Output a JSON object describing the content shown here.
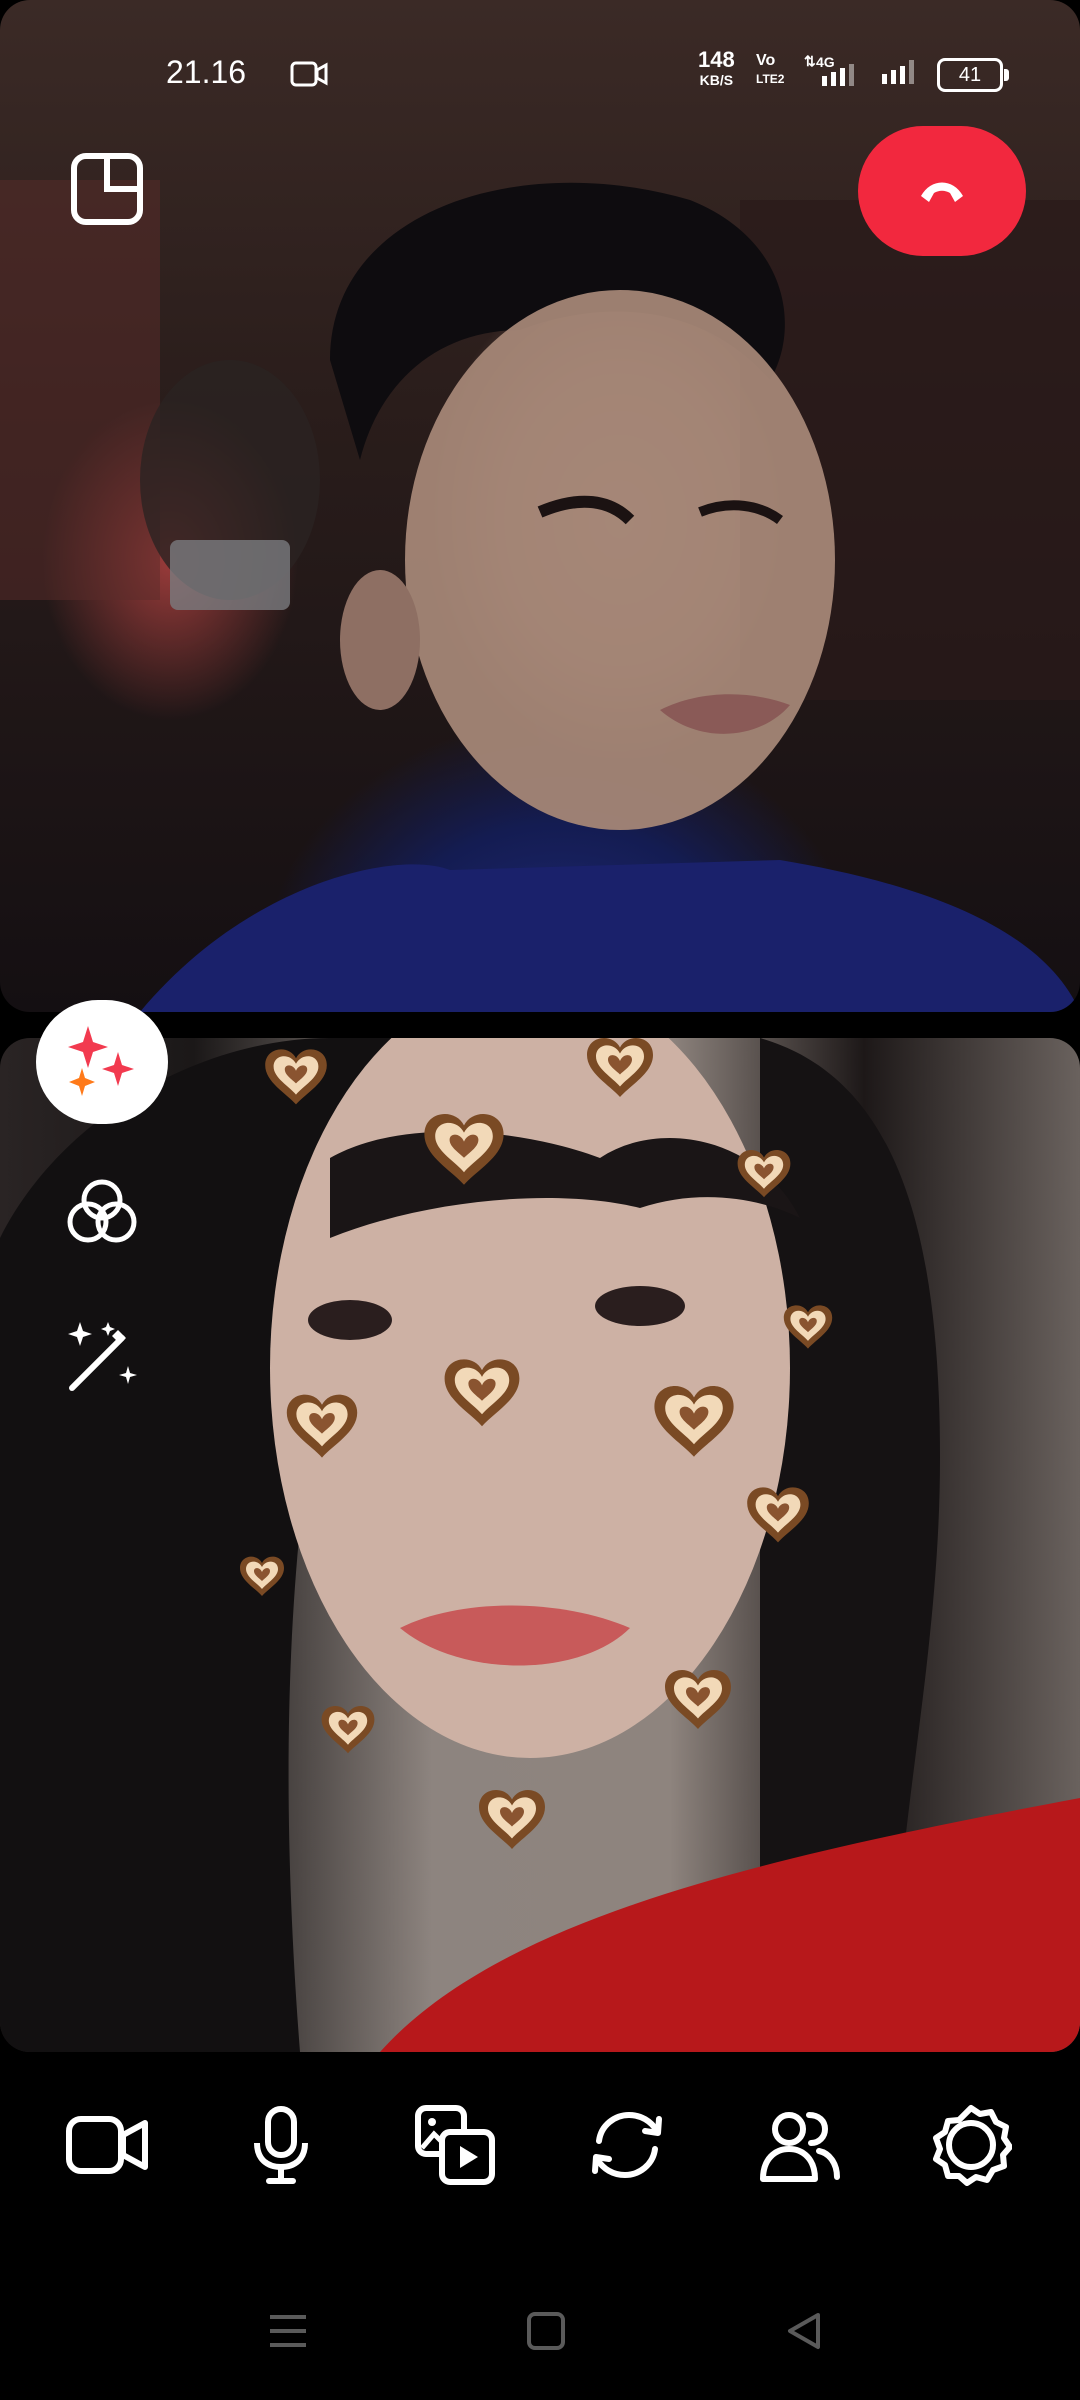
{
  "status_bar": {
    "time": "21.16",
    "net_speed_value": "148",
    "net_speed_unit": "KB/S",
    "volte_top": "Vo",
    "volte_bottom": "LTE2",
    "network_type": "4G",
    "battery_level": "41"
  },
  "icons": {
    "status_camera": "video-camera-icon",
    "layout": "layout-toggle-icon",
    "end_call": "hang-up-phone-icon",
    "effects": "sparkles-icon",
    "filters": "filter-circles-icon",
    "beauty": "magic-wand-icon",
    "controls": [
      "video-camera-icon",
      "microphone-icon",
      "share-media-icon",
      "switch-camera-icon",
      "add-participants-icon",
      "settings-gear-icon"
    ],
    "nav": [
      "recent-apps-icon",
      "home-icon",
      "back-icon"
    ]
  },
  "colors": {
    "end_call": "#f2283e",
    "effects_sparkle_red": "#f23a4f",
    "effects_sparkle_orange": "#ff7a1a",
    "background": "#000000"
  }
}
